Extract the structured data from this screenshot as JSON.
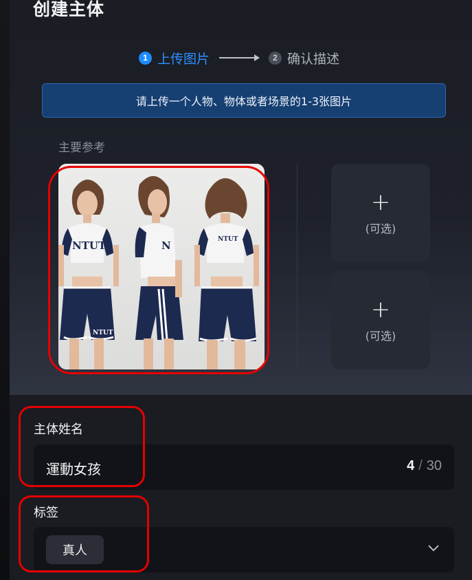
{
  "page": {
    "title": "创建主体"
  },
  "steps": [
    {
      "number": "1",
      "label": "上传图片",
      "active": true
    },
    {
      "number": "2",
      "label": "确认描述",
      "active": false
    }
  ],
  "notice": {
    "text": "请上传一个人物、物体或者场景的1-3张图片"
  },
  "references": {
    "main_label": "主要参考",
    "main_image": {
      "shirt_text": "NTUT",
      "description_icon": "reference-photo"
    },
    "optional_slots": [
      {
        "plus": "+",
        "text": "(可选)"
      },
      {
        "plus": "+",
        "text": "(可选)"
      }
    ]
  },
  "name_field": {
    "label": "主体姓名",
    "value": "運動女孩",
    "count": "4",
    "separator": "/",
    "max": "30"
  },
  "tags_field": {
    "label": "标签",
    "selected": "真人",
    "dropdown_icon": "chevron-down-icon"
  },
  "colors": {
    "accent": "#1c8cff",
    "notice_bg": "#163f72",
    "highlight": "#e60000"
  }
}
